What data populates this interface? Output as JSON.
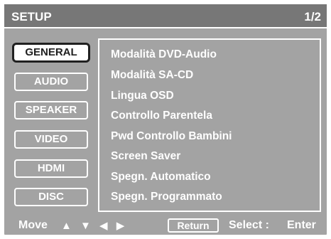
{
  "header": {
    "title": "SETUP",
    "page_indicator": "1/2"
  },
  "tabs": [
    {
      "label": "GENERAL",
      "active": true
    },
    {
      "label": "AUDIO",
      "active": false
    },
    {
      "label": "SPEAKER",
      "active": false
    },
    {
      "label": "VIDEO",
      "active": false
    },
    {
      "label": "HDMI",
      "active": false
    },
    {
      "label": "DISC",
      "active": false
    }
  ],
  "menu_items": [
    "Modalità DVD-Audio",
    "Modalità SA-CD",
    "Lingua OSD",
    "Controllo Parentela",
    "Pwd Controllo Bambini",
    "Screen Saver",
    "Spegn. Automatico",
    "Spegn. Programmato"
  ],
  "footer": {
    "move_label": "Move",
    "arrows": "▲ ▼ ◀ ▶",
    "return_label": "Return",
    "select_label": "Select :",
    "enter_label": "Enter"
  },
  "colors": {
    "panel": "#a3a3a3",
    "header": "#777777",
    "text": "#ffffff",
    "active_tab_bg": "#ffffff",
    "active_tab_text": "#202020"
  }
}
